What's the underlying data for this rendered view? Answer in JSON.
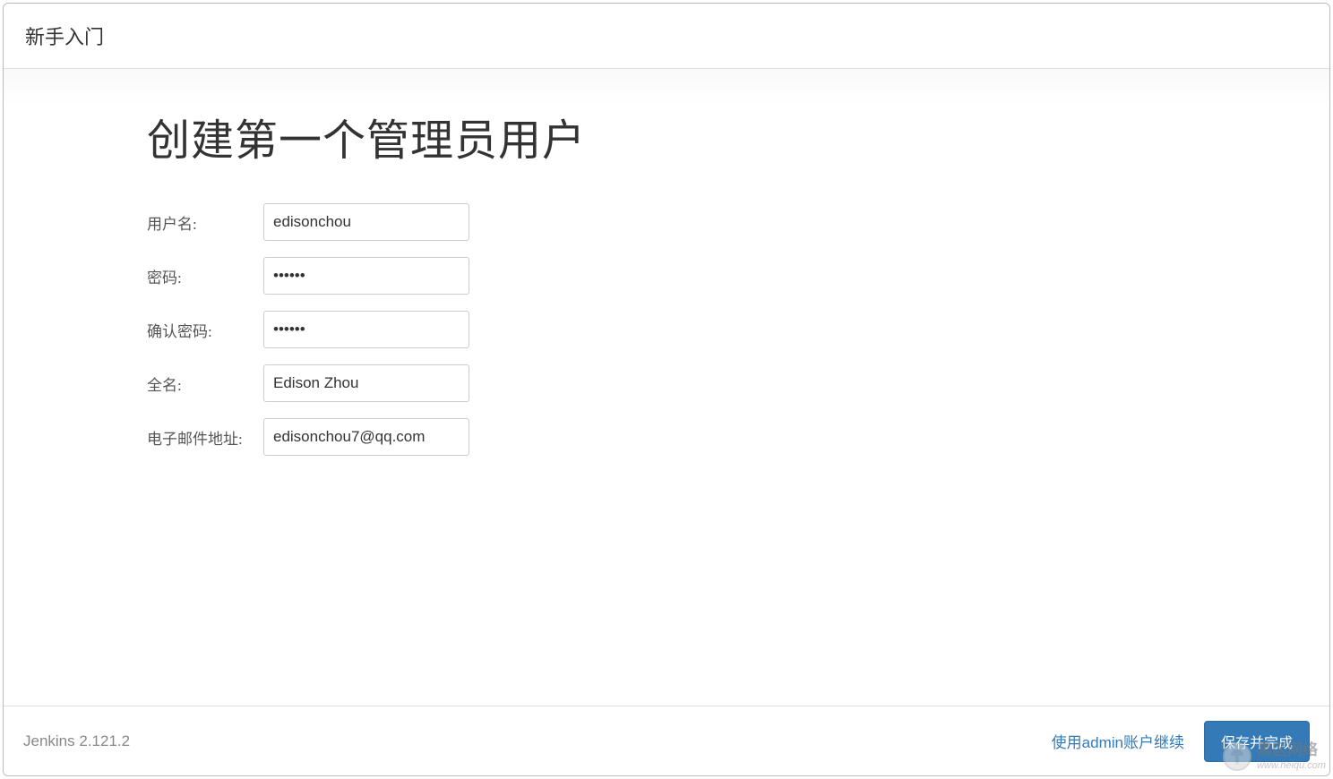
{
  "header": {
    "title": "新手入门"
  },
  "main": {
    "page_title": "创建第一个管理员用户",
    "form": {
      "username_label": "用户名:",
      "username_value": "edisonchou",
      "password_label": "密码:",
      "password_value": "••••••",
      "confirm_password_label": "确认密码:",
      "confirm_password_value": "••••••",
      "fullname_label": "全名:",
      "fullname_value": "Edison Zhou",
      "email_label": "电子邮件地址:",
      "email_value": "edisonchou7@qq.com"
    }
  },
  "footer": {
    "version_text": "Jenkins 2.121.2",
    "continue_as_admin_text": "使用admin账户继续",
    "save_button_label": "保存并完成"
  },
  "watermark": {
    "text_top": "黑区网络",
    "text_bottom": "www.heiqu.com"
  }
}
